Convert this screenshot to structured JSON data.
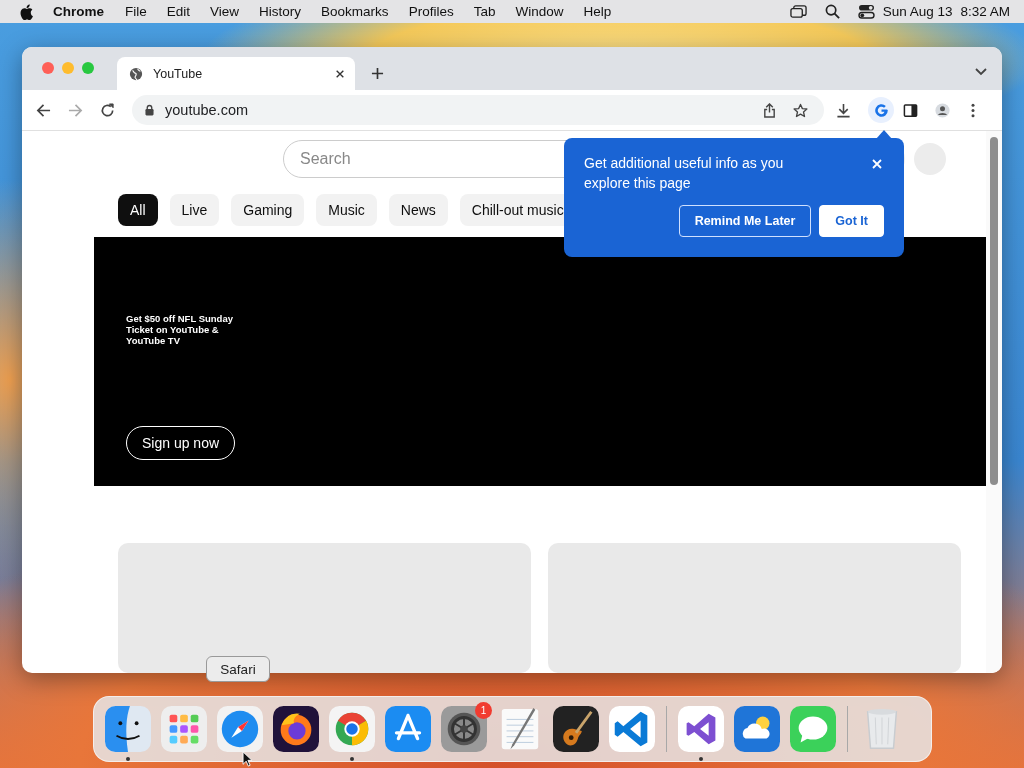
{
  "menu_bar": {
    "app": "Chrome",
    "menus": [
      "File",
      "Edit",
      "View",
      "History",
      "Bookmarks",
      "Profiles",
      "Tab",
      "Window",
      "Help"
    ],
    "date": "Sun Aug 13",
    "time": "8:32 AM"
  },
  "browser": {
    "tabs": [
      {
        "title": "YouTube",
        "selected": true
      }
    ],
    "address": "youtube.com"
  },
  "page": {
    "search": {
      "placeholder": "Search"
    },
    "chips": [
      {
        "label": "All",
        "selected": true
      },
      {
        "label": "Live",
        "selected": false
      },
      {
        "label": "Gaming",
        "selected": false
      },
      {
        "label": "Music",
        "selected": false
      },
      {
        "label": "News",
        "selected": false
      },
      {
        "label": "Chill-out music",
        "selected": false
      }
    ],
    "banner": {
      "text": "Get $50 off NFL Sunday Ticket on YouTube & YouTube TV",
      "button": "Sign up now"
    },
    "cards": [
      {
        "kind": "placeholder"
      },
      {
        "kind": "placeholder"
      }
    ]
  },
  "popup": {
    "message": "Get additional useful info as you explore this page",
    "buttons": [
      {
        "label": "Remind Me Later",
        "kind": "secondary"
      },
      {
        "label": "Got It",
        "kind": "primary"
      }
    ]
  },
  "dock": {
    "tooltip": "Safari",
    "apps": [
      {
        "kind": "finder",
        "running": true
      },
      {
        "kind": "launchpad",
        "running": false
      },
      {
        "kind": "safari",
        "running": false
      },
      {
        "kind": "firefox",
        "running": false
      },
      {
        "kind": "chrome",
        "running": true
      },
      {
        "kind": "appstore",
        "running": false
      },
      {
        "kind": "settings",
        "running": false,
        "badge": "1"
      },
      {
        "kind": "textedit",
        "running": false
      },
      {
        "kind": "guitar",
        "running": false
      },
      {
        "kind": "vscode",
        "running": false
      },
      {
        "kind": "separator"
      },
      {
        "kind": "vstudio",
        "running": true
      },
      {
        "kind": "weather",
        "running": false
      },
      {
        "kind": "messages",
        "running": false
      },
      {
        "kind": "separator"
      },
      {
        "kind": "trash",
        "running": false
      }
    ]
  }
}
